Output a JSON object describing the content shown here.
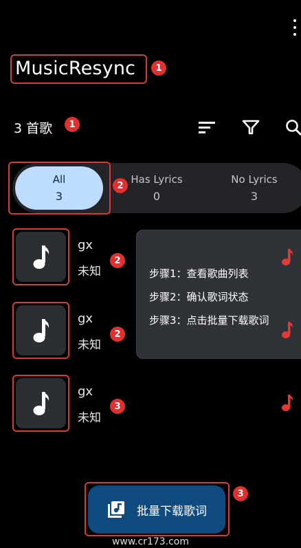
{
  "header": {
    "app_title": "MusicResync",
    "title_badge": "1"
  },
  "summary": {
    "count_text": "3 首歌",
    "count_badge": "1"
  },
  "toolbar": {
    "icons": [
      "sort-icon",
      "filter-icon",
      "search-icon"
    ]
  },
  "filter_tabs": {
    "badge": "2",
    "items": [
      {
        "label": "All",
        "count": "3",
        "selected": true
      },
      {
        "label": "Has Lyrics",
        "count": "0",
        "selected": false
      },
      {
        "label": "No Lyrics",
        "count": "3",
        "selected": false
      }
    ]
  },
  "songs": [
    {
      "title": "gx",
      "artist": "未知",
      "badge": "2"
    },
    {
      "title": "gx",
      "artist": "未知",
      "badge": "2"
    },
    {
      "title": "gx",
      "artist": "未知",
      "badge": "3"
    }
  ],
  "tooltip": {
    "lines": [
      "步骤1：查看歌曲列表",
      "步骤2：确认歌词状态",
      "步骤3：点击批量下载歌词"
    ]
  },
  "fab": {
    "label": "批量下载歌词",
    "badge": "3"
  },
  "watermark": "www.cr173.com",
  "colors": {
    "accent_red": "#e03030",
    "selected_tab": "#bddcff",
    "fab_bg": "#104b80"
  }
}
